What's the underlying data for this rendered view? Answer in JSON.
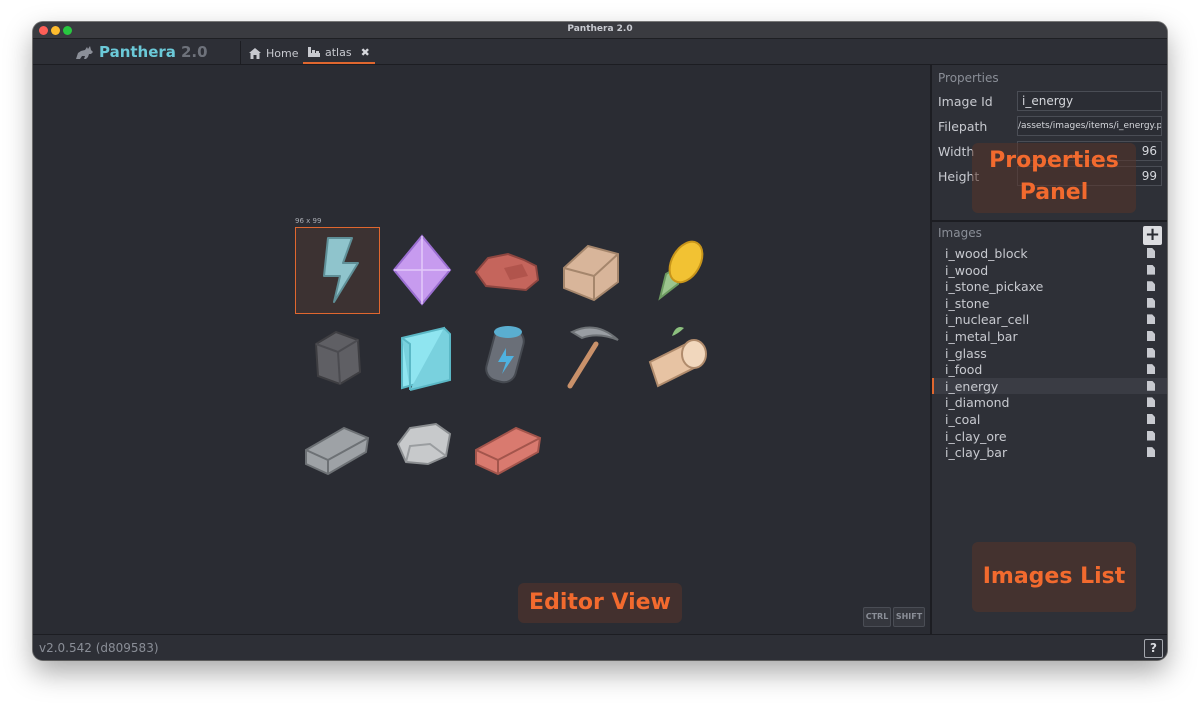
{
  "window": {
    "title": "Panthera 2.0"
  },
  "brand": {
    "name": "Panthera",
    "version": "2.0"
  },
  "tabs": [
    {
      "label": "Home",
      "icon": "home-icon"
    },
    {
      "label": "atlas",
      "icon": "atlas-icon",
      "active": true
    }
  ],
  "editor": {
    "selection_size": "96 x 99",
    "modifier_keys": [
      "CTRL",
      "SHIFT"
    ],
    "sprites": [
      "energy",
      "diamond",
      "clay_ore",
      "wood_block",
      "food",
      "coal",
      "glass",
      "nuclear_cell",
      "stone_pickaxe",
      "wood",
      "metal_bar",
      "stone",
      "clay_bar"
    ]
  },
  "properties": {
    "title": "Properties",
    "fields": [
      {
        "label": "Image Id",
        "value": "i_energy"
      },
      {
        "label": "Filepath",
        "value": "/assets/images/items/i_energy.png"
      },
      {
        "label": "Width",
        "value": "96"
      },
      {
        "label": "Height",
        "value": "99"
      }
    ]
  },
  "images": {
    "title": "Images",
    "selected": "i_energy",
    "items": [
      "i_wood_block",
      "i_wood",
      "i_stone_pickaxe",
      "i_stone",
      "i_nuclear_cell",
      "i_metal_bar",
      "i_glass",
      "i_food",
      "i_energy",
      "i_diamond",
      "i_coal",
      "i_clay_ore",
      "i_clay_bar"
    ]
  },
  "callouts": {
    "properties_line1": "Properties",
    "properties_line2": "Panel",
    "images_list": "Images List",
    "editor_view": "Editor View"
  },
  "status": {
    "version": "v2.0.542 (d809583)",
    "help": "?"
  },
  "colors": {
    "accent": "#e0672f",
    "brand": "#6bc9d8",
    "callout_text": "#f26a2e",
    "background": "#2a2c33"
  }
}
